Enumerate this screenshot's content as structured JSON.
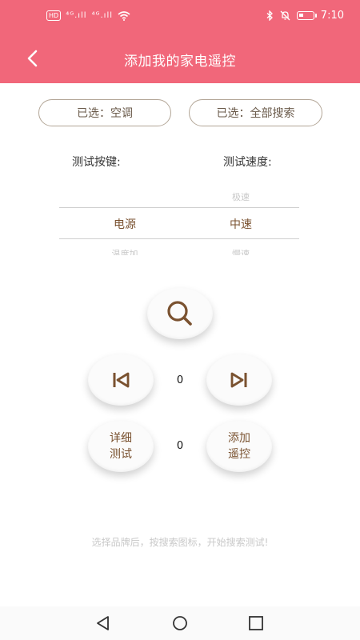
{
  "status_bar": {
    "hd_badge": "HD",
    "net1": "⁴ᴳ.ıll",
    "net2": "⁴ᴳ.ıll",
    "time": "7:10"
  },
  "header": {
    "title": "添加我的家电遥控",
    "back_icon": "chevron-left-icon"
  },
  "selectors": {
    "device": "已选：空调",
    "brand": "已选：全部搜索"
  },
  "labels": {
    "test_key": "测试按键:",
    "test_speed": "测试速度:"
  },
  "key_wheel": {
    "above": "",
    "selected": "电源",
    "below": "温度加"
  },
  "speed_wheel": {
    "above": "极速",
    "selected": "中速",
    "below": "慢速"
  },
  "controls": {
    "search_icon": "search-icon",
    "prev_icon": "skip-previous-icon",
    "next_icon": "skip-next-icon",
    "counter_top": "0",
    "counter_bottom": "0",
    "detail_test_line1": "详细",
    "detail_test_line2": "测试",
    "add_remote_line1": "添加",
    "add_remote_line2": "遥控"
  },
  "hint": "选择品牌后，按搜索图标，开始搜索测试!",
  "colors": {
    "brand_pink": "#f1677a",
    "accent_brown": "#7a5230",
    "pill_border": "#b3a697"
  },
  "nav_bar": {
    "back": "triangle-back-icon",
    "home": "circle-home-icon",
    "recents": "square-recents-icon"
  }
}
